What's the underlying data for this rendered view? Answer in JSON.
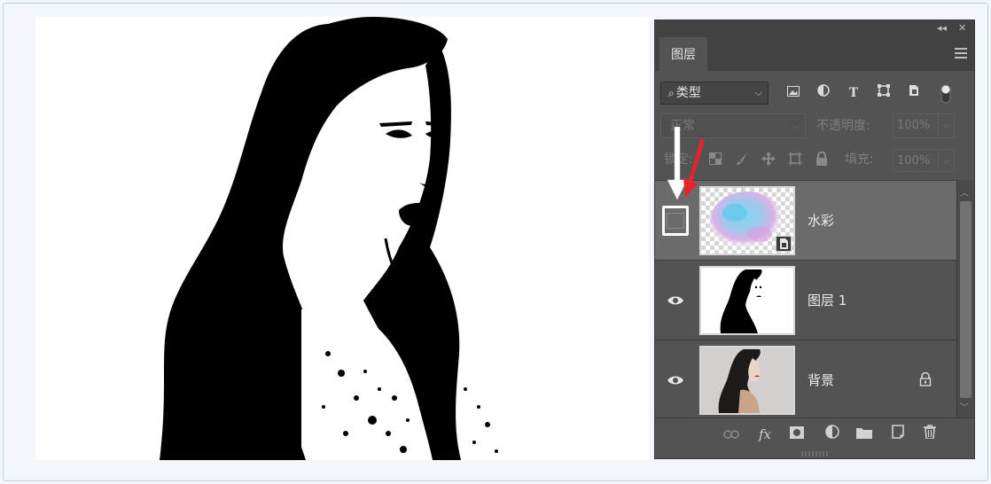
{
  "panel": {
    "collapse_glyph": "◂◂",
    "close_glyph": "✕",
    "tab_label": "图层",
    "filter": {
      "search_glyph": "⌕",
      "kind_label": "类型",
      "chevron": "⌵",
      "icons": [
        "image-filter-icon",
        "adjustment-filter-icon",
        "type-filter-icon",
        "shape-filter-icon",
        "smart-object-filter-icon",
        "filter-toggle-icon"
      ],
      "type_glyph": "T"
    },
    "blend_mode": "正常",
    "opacity_label": "不透明度:",
    "opacity_value": "100%",
    "lock_label": "锁定:",
    "fill_label": "填充:",
    "fill_value": "100%",
    "layers": [
      {
        "name": "水彩",
        "visible": false,
        "selected": true,
        "thumbnail": "watercolor-splash"
      },
      {
        "name": "图层 1",
        "visible": true,
        "selected": false,
        "thumbnail": "black-white-portrait"
      },
      {
        "name": "背景",
        "visible": true,
        "selected": false,
        "locked": true,
        "thumbnail": "color-portrait"
      }
    ],
    "bottom_icons": [
      "link-icon",
      "fx-icon",
      "mask-icon",
      "adjustment-icon",
      "folder-icon",
      "new-layer-icon",
      "trash-icon"
    ],
    "fx_label": "fx"
  },
  "annotations": {
    "arrow_colors": {
      "white": "#ffffff",
      "red": "#e8242a"
    }
  }
}
